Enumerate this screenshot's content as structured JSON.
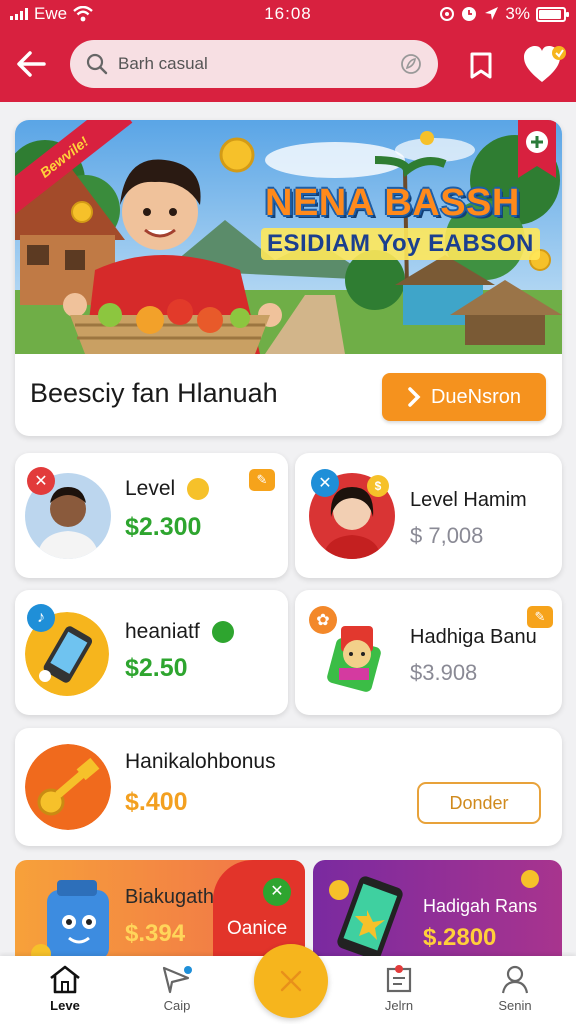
{
  "status_bar": {
    "carrier": "Ewe",
    "time": "16:08",
    "battery": "3%"
  },
  "header": {
    "search_placeholder": "Barh casual"
  },
  "hero": {
    "ribbon": "Bewvile!",
    "title": "NENA BASSH",
    "subtitle": "ESIDIAM Yoy EABSON",
    "caption": "Beesciy fan Hlanuah",
    "button_label": "DueNsron"
  },
  "tiles": [
    {
      "title": "Level",
      "price": "$2.300"
    },
    {
      "title": "Level Hamim",
      "price": "$ 7,008"
    },
    {
      "title": "heaniatf",
      "price": "$2.50"
    },
    {
      "title": "Hadhiga Banu",
      "price": "$3.908"
    },
    {
      "title": "Hanikalohbonus",
      "price": "$.400",
      "button_label": "Donder"
    }
  ],
  "promos": [
    {
      "title": "Biakugath",
      "price": "$.394",
      "badge": "Oanice"
    },
    {
      "title": "Hadigah Rans",
      "price": "$.2800"
    }
  ],
  "bottom_nav": [
    {
      "label": "Leve",
      "icon": "home-icon",
      "active": true
    },
    {
      "label": "Caip",
      "icon": "paper-plane-icon"
    },
    {
      "label": "Jelrn",
      "icon": "calendar-icon"
    },
    {
      "label": "Senin",
      "icon": "profile-icon"
    }
  ],
  "colors": {
    "brand_red": "#d8213f",
    "accent_orange": "#f5921e",
    "price_green": "#2ea52f",
    "fab_yellow": "#f6b51d"
  }
}
